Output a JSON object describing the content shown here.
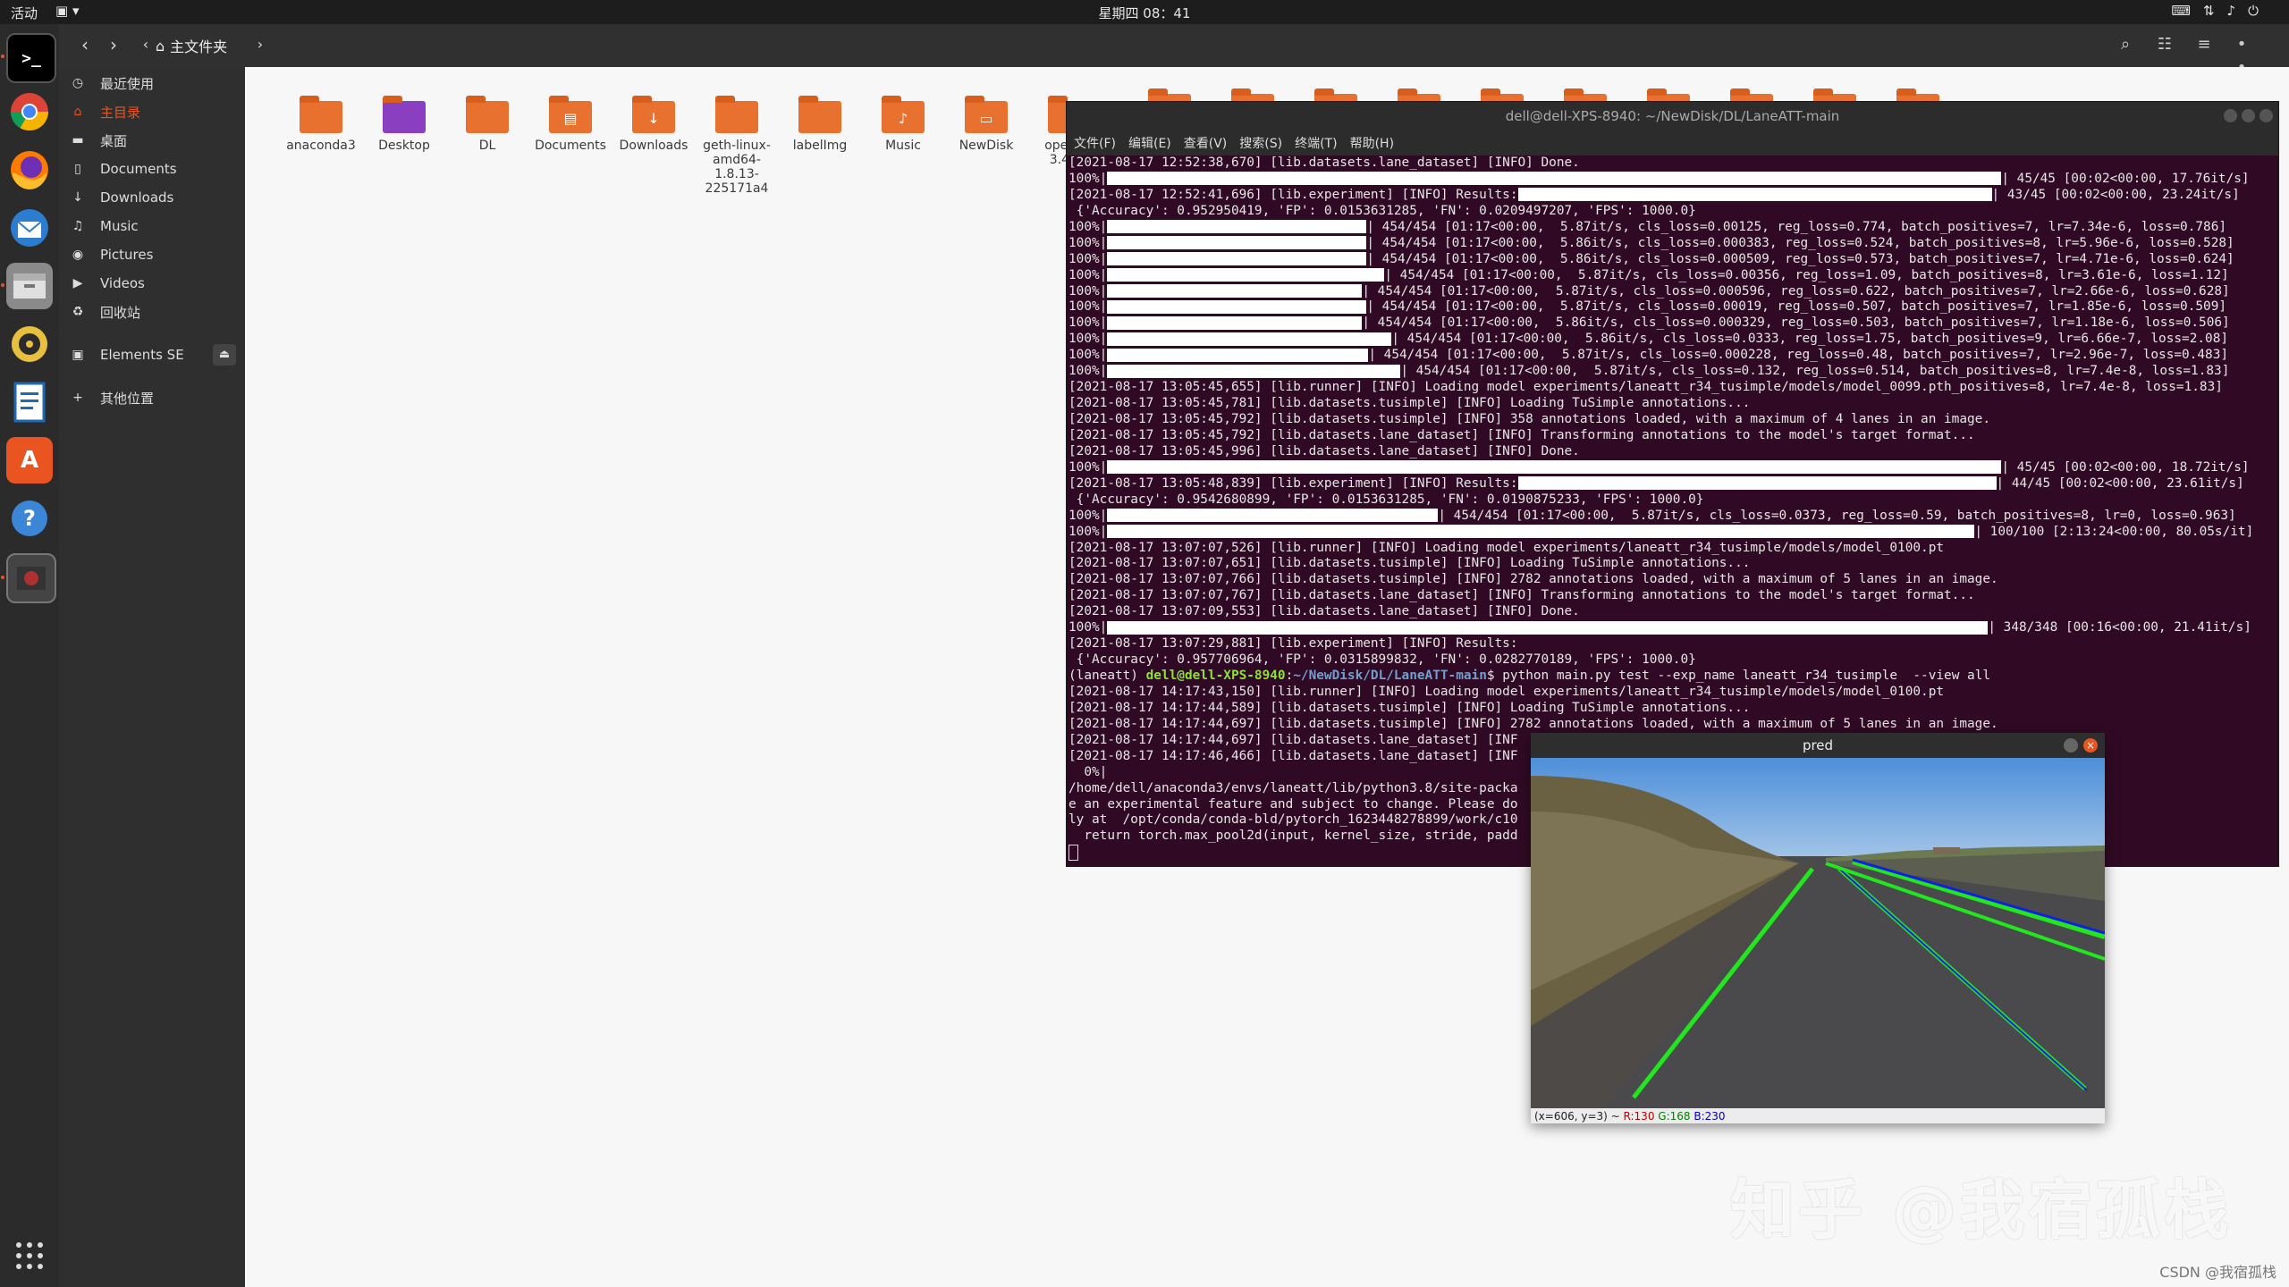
{
  "topbar": {
    "activities": "活动",
    "clock": "星期四 08：41",
    "tray_icons": [
      "keyboard-icon",
      "network-icon",
      "volume-icon",
      "power-icon"
    ]
  },
  "dock": {
    "apps": [
      "terminal-icon",
      "chrome-icon",
      "firefox-icon",
      "thunderbird-icon",
      "files-icon",
      "rhythmbox-icon",
      "writer-icon",
      "software-icon",
      "help-icon",
      "app-icon"
    ],
    "grid_icon": "show-apps-icon"
  },
  "files": {
    "path_home": "主文件夹",
    "sidebar": [
      {
        "label": "最近使用",
        "icon": "clock-icon",
        "active": false
      },
      {
        "label": "主目录",
        "icon": "home-icon",
        "active": true
      },
      {
        "label": "桌面",
        "icon": "desktop-icon",
        "active": false
      },
      {
        "label": "Documents",
        "icon": "doc-icon",
        "active": false
      },
      {
        "label": "Downloads",
        "icon": "download-icon",
        "active": false
      },
      {
        "label": "Music",
        "icon": "music-icon",
        "active": false
      },
      {
        "label": "Pictures",
        "icon": "camera-icon",
        "active": false
      },
      {
        "label": "Videos",
        "icon": "video-icon",
        "active": false
      },
      {
        "label": "回收站",
        "icon": "trash-icon",
        "active": false
      },
      {
        "label": "Elements SE",
        "icon": "drive-icon",
        "active": false
      },
      {
        "label": "其他位置",
        "icon": "plus-icon",
        "active": false
      }
    ],
    "items": [
      {
        "name": "anaconda3",
        "lines": [
          "anaconda3"
        ]
      },
      {
        "name": "Desktop",
        "lines": [
          "Desktop"
        ]
      },
      {
        "name": "DL",
        "lines": [
          "DL"
        ]
      },
      {
        "name": "Documents",
        "lines": [
          "Documents"
        ]
      },
      {
        "name": "Downloads",
        "lines": [
          "Downloads"
        ]
      },
      {
        "name": "geth-linux-amd64-1.8.13-225171a4",
        "lines": [
          "geth-linux-",
          "amd64-",
          "1.8.13-",
          "225171a4"
        ]
      },
      {
        "name": "labelImg",
        "lines": [
          "labelImg"
        ]
      },
      {
        "name": "Music",
        "lines": [
          "Music"
        ]
      },
      {
        "name": "NewDisk",
        "lines": [
          "NewDisk"
        ]
      },
      {
        "name": "opencv-3.4.14",
        "lines": [
          "opencv-",
          "3.4.14"
        ]
      }
    ]
  },
  "terminal": {
    "title": "dell@dell-XPS-8940: ~/NewDisk/DL/LaneATT-main",
    "menu": [
      "文件(F)",
      "编辑(E)",
      "查看(V)",
      "搜索(S)",
      "终端(T)",
      "帮助(H)"
    ],
    "lines": [
      {
        "t": "[2021-08-17 12:52:38,670] [lib.datasets.lane_dataset] [INFO] Done."
      },
      {
        "p": "100%|",
        "bar": 1000,
        "s": "| 45/45 [00:02<00:00, 17.76it/s]"
      },
      {
        "t": "[2021-08-17 12:52:41,696] [lib.experiment] [INFO] Results:",
        "bar": 530,
        "s": "| 43/45 [00:02<00:00, 23.24it/s]"
      },
      {
        "t": " {'Accuracy': 0.952950419, 'FP': 0.0153631285, 'FN': 0.0209497207, 'FPS': 1000.0}"
      },
      {
        "p": "100%|",
        "bar": 290,
        "s": "| 454/454 [01:17<00:00,  5.87it/s, cls_loss=0.00125, reg_loss=0.774, batch_positives=7, lr=7.34e-6, loss=0.786]"
      },
      {
        "p": "100%|",
        "bar": 290,
        "s": "| 454/454 [01:17<00:00,  5.86it/s, cls_loss=0.000383, reg_loss=0.524, batch_positives=8, lr=5.96e-6, loss=0.528]"
      },
      {
        "p": "100%|",
        "bar": 290,
        "s": "| 454/454 [01:17<00:00,  5.86it/s, cls_loss=0.000509, reg_loss=0.573, batch_positives=7, lr=4.71e-6, loss=0.624]"
      },
      {
        "p": "100%|",
        "bar": 310,
        "s": "| 454/454 [01:17<00:00,  5.87it/s, cls_loss=0.00356, reg_loss=1.09, batch_positives=8, lr=3.61e-6, loss=1.12]"
      },
      {
        "p": "100%|",
        "bar": 285,
        "s": "| 454/454 [01:17<00:00,  5.87it/s, cls_loss=0.000596, reg_loss=0.622, batch_positives=7, lr=2.66e-6, loss=0.628]"
      },
      {
        "p": "100%|",
        "bar": 290,
        "s": "| 454/454 [01:17<00:00,  5.87it/s, cls_loss=0.00019, reg_loss=0.507, batch_positives=7, lr=1.85e-6, loss=0.509]"
      },
      {
        "p": "100%|",
        "bar": 285,
        "s": "| 454/454 [01:17<00:00,  5.86it/s, cls_loss=0.000329, reg_loss=0.503, batch_positives=7, lr=1.18e-6, loss=0.506]"
      },
      {
        "p": "100%|",
        "bar": 318,
        "s": "| 454/454 [01:17<00:00,  5.86it/s, cls_loss=0.0333, reg_loss=1.75, batch_positives=9, lr=6.66e-7, loss=2.08]"
      },
      {
        "p": "100%|",
        "bar": 292,
        "s": "| 454/454 [01:17<00:00,  5.87it/s, cls_loss=0.000228, reg_loss=0.48, batch_positives=7, lr=2.96e-7, loss=0.483]"
      },
      {
        "p": "100%|",
        "bar": 328,
        "s": "| 454/454 [01:17<00:00,  5.87it/s, cls_loss=0.132, reg_loss=0.514, batch_positives=8, lr=7.4e-8, loss=1.83]"
      },
      {
        "t": "[2021-08-17 13:05:45,655] [lib.runner] [INFO] Loading model experiments/laneatt_r34_tusimple/models/model_0099.pth_positives=8, lr=7.4e-8, loss=1.83]"
      },
      {
        "t": "[2021-08-17 13:05:45,781] [lib.datasets.tusimple] [INFO] Loading TuSimple annotations..."
      },
      {
        "t": "[2021-08-17 13:05:45,792] [lib.datasets.tusimple] [INFO] 358 annotations loaded, with a maximum of 4 lanes in an image."
      },
      {
        "t": "[2021-08-17 13:05:45,792] [lib.datasets.lane_dataset] [INFO] Transforming annotations to the model's target format..."
      },
      {
        "t": "[2021-08-17 13:05:45,996] [lib.datasets.lane_dataset] [INFO] Done."
      },
      {
        "p": "100%|",
        "bar": 1000,
        "s": "| 45/45 [00:02<00:00, 18.72it/s]"
      },
      {
        "t": "[2021-08-17 13:05:48,839] [lib.experiment] [INFO] Results:",
        "bar": 535,
        "s": "| 44/45 [00:02<00:00, 23.61it/s]"
      },
      {
        "t": " {'Accuracy': 0.9542680899, 'FP': 0.0153631285, 'FN': 0.0190875233, 'FPS': 1000.0}"
      },
      {
        "p": "100%|",
        "bar": 370,
        "s": "| 454/454 [01:17<00:00,  5.87it/s, cls_loss=0.0373, reg_loss=0.59, batch_positives=8, lr=0, loss=0.963]"
      },
      {
        "p": "100%|",
        "bar": 970,
        "s": "| 100/100 [2:13:24<00:00, 80.05s/it]"
      },
      {
        "t": "[2021-08-17 13:07:07,526] [lib.runner] [INFO] Loading model experiments/laneatt_r34_tusimple/models/model_0100.pt"
      },
      {
        "t": "[2021-08-17 13:07:07,651] [lib.datasets.tusimple] [INFO] Loading TuSimple annotations..."
      },
      {
        "t": "[2021-08-17 13:07:07,766] [lib.datasets.tusimple] [INFO] 2782 annotations loaded, with a maximum of 5 lanes in an image."
      },
      {
        "t": "[2021-08-17 13:07:07,767] [lib.datasets.lane_dataset] [INFO] Transforming annotations to the model's target format..."
      },
      {
        "t": "[2021-08-17 13:07:09,553] [lib.datasets.lane_dataset] [INFO] Done."
      },
      {
        "p": "100%|",
        "bar": 985,
        "s": "| 348/348 [00:16<00:00, 21.41it/s]"
      },
      {
        "t": "[2021-08-17 13:07:29,881] [lib.experiment] [INFO] Results:"
      },
      {
        "t": " {'Accuracy': 0.957706964, 'FP': 0.0315899832, 'FN': 0.0282770189, 'FPS': 1000.0}"
      },
      {
        "prompt": true,
        "env": "(laneatt) ",
        "user": "dell@dell-XPS-8940",
        "sep": ":",
        "path": "~/NewDisk/DL/LaneATT-main",
        "cmd": "$ python main.py test --exp_name laneatt_r34_tusimple  --view all"
      },
      {
        "t": "[2021-08-17 14:17:43,150] [lib.runner] [INFO] Loading model experiments/laneatt_r34_tusimple/models/model_0100.pt"
      },
      {
        "t": "[2021-08-17 14:17:44,589] [lib.datasets.tusimple] [INFO] Loading TuSimple annotations..."
      },
      {
        "t": "[2021-08-17 14:17:44,697] [lib.datasets.tusimple] [INFO] 2782 annotations loaded, with a maximum of 5 lanes in an image."
      },
      {
        "t": "[2021-08-17 14:17:44,697] [lib.datasets.lane_dataset] [INF"
      },
      {
        "t": "[2021-08-17 14:17:46,466] [lib.datasets.lane_dataset] [INF"
      },
      {
        "t": "  0%|                                                                                                     782 [00:00<?, ?it/s]"
      },
      {
        "t": "/home/dell/anaconda3/envs/laneatt/lib/python3.8/site-packa                                                    associated APIs ar"
      },
      {
        "t": "e an experimental feature and subject to change. Please do                                                   (Triggered internal"
      },
      {
        "t": "ly at  /opt/conda/conda-bld/pytorch_1623448278899/work/c10"
      },
      {
        "t": "  return torch.max_pool2d(input, kernel_size, stride, padd"
      },
      {
        "cursor": true
      }
    ]
  },
  "pred": {
    "title": "pred",
    "status_prefix": "(x=606, y=3) ~ ",
    "status_r": "R:130",
    "status_g": "G:168",
    "status_b": "B:230",
    "colors": {
      "lane_green": "#22e61e",
      "lane_blue": "#1020e0"
    }
  },
  "watermark": "知乎 @我宿孤栈",
  "csdn": "CSDN @我宿孤栈"
}
